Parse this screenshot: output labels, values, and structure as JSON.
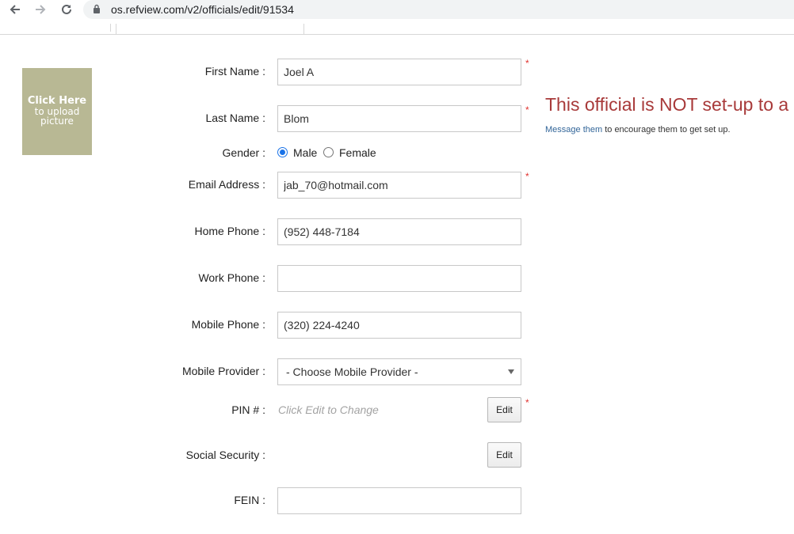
{
  "browser": {
    "url": "os.refview.com/v2/officials/edit/91534"
  },
  "upload": {
    "line1": "Click Here",
    "line2": "to upload",
    "line3": "picture"
  },
  "form": {
    "first_name": {
      "label": "First Name :",
      "value": "Joel A"
    },
    "last_name": {
      "label": "Last Name :",
      "value": "Blom"
    },
    "gender": {
      "label": "Gender :",
      "options": [
        "Male",
        "Female"
      ],
      "selected": "Male"
    },
    "email": {
      "label": "Email Address :",
      "value": "jab_70@hotmail.com"
    },
    "home_phone": {
      "label": "Home Phone :",
      "value": "(952) 448-7184"
    },
    "work_phone": {
      "label": "Work Phone :",
      "value": ""
    },
    "mobile_phone": {
      "label": "Mobile Phone :",
      "value": "(320) 224-4240"
    },
    "mobile_provider": {
      "label": "Mobile Provider :",
      "value": "- Choose Mobile Provider -"
    },
    "pin": {
      "label": "PIN # :",
      "hint": "Click Edit to Change",
      "button": "Edit"
    },
    "ssn": {
      "label": "Social Security :",
      "button": "Edit"
    },
    "fein": {
      "label": "FEIN :",
      "value": ""
    },
    "required_mark": "*"
  },
  "notice": {
    "title": "This official is NOT set-up to a",
    "link": "Message them",
    "text": " to encourage them to get set up."
  },
  "colors": {
    "upload_bg": "#b8b894",
    "notice_red": "#a83a3a",
    "required_red": "#e0322e",
    "link_blue": "#336699"
  }
}
